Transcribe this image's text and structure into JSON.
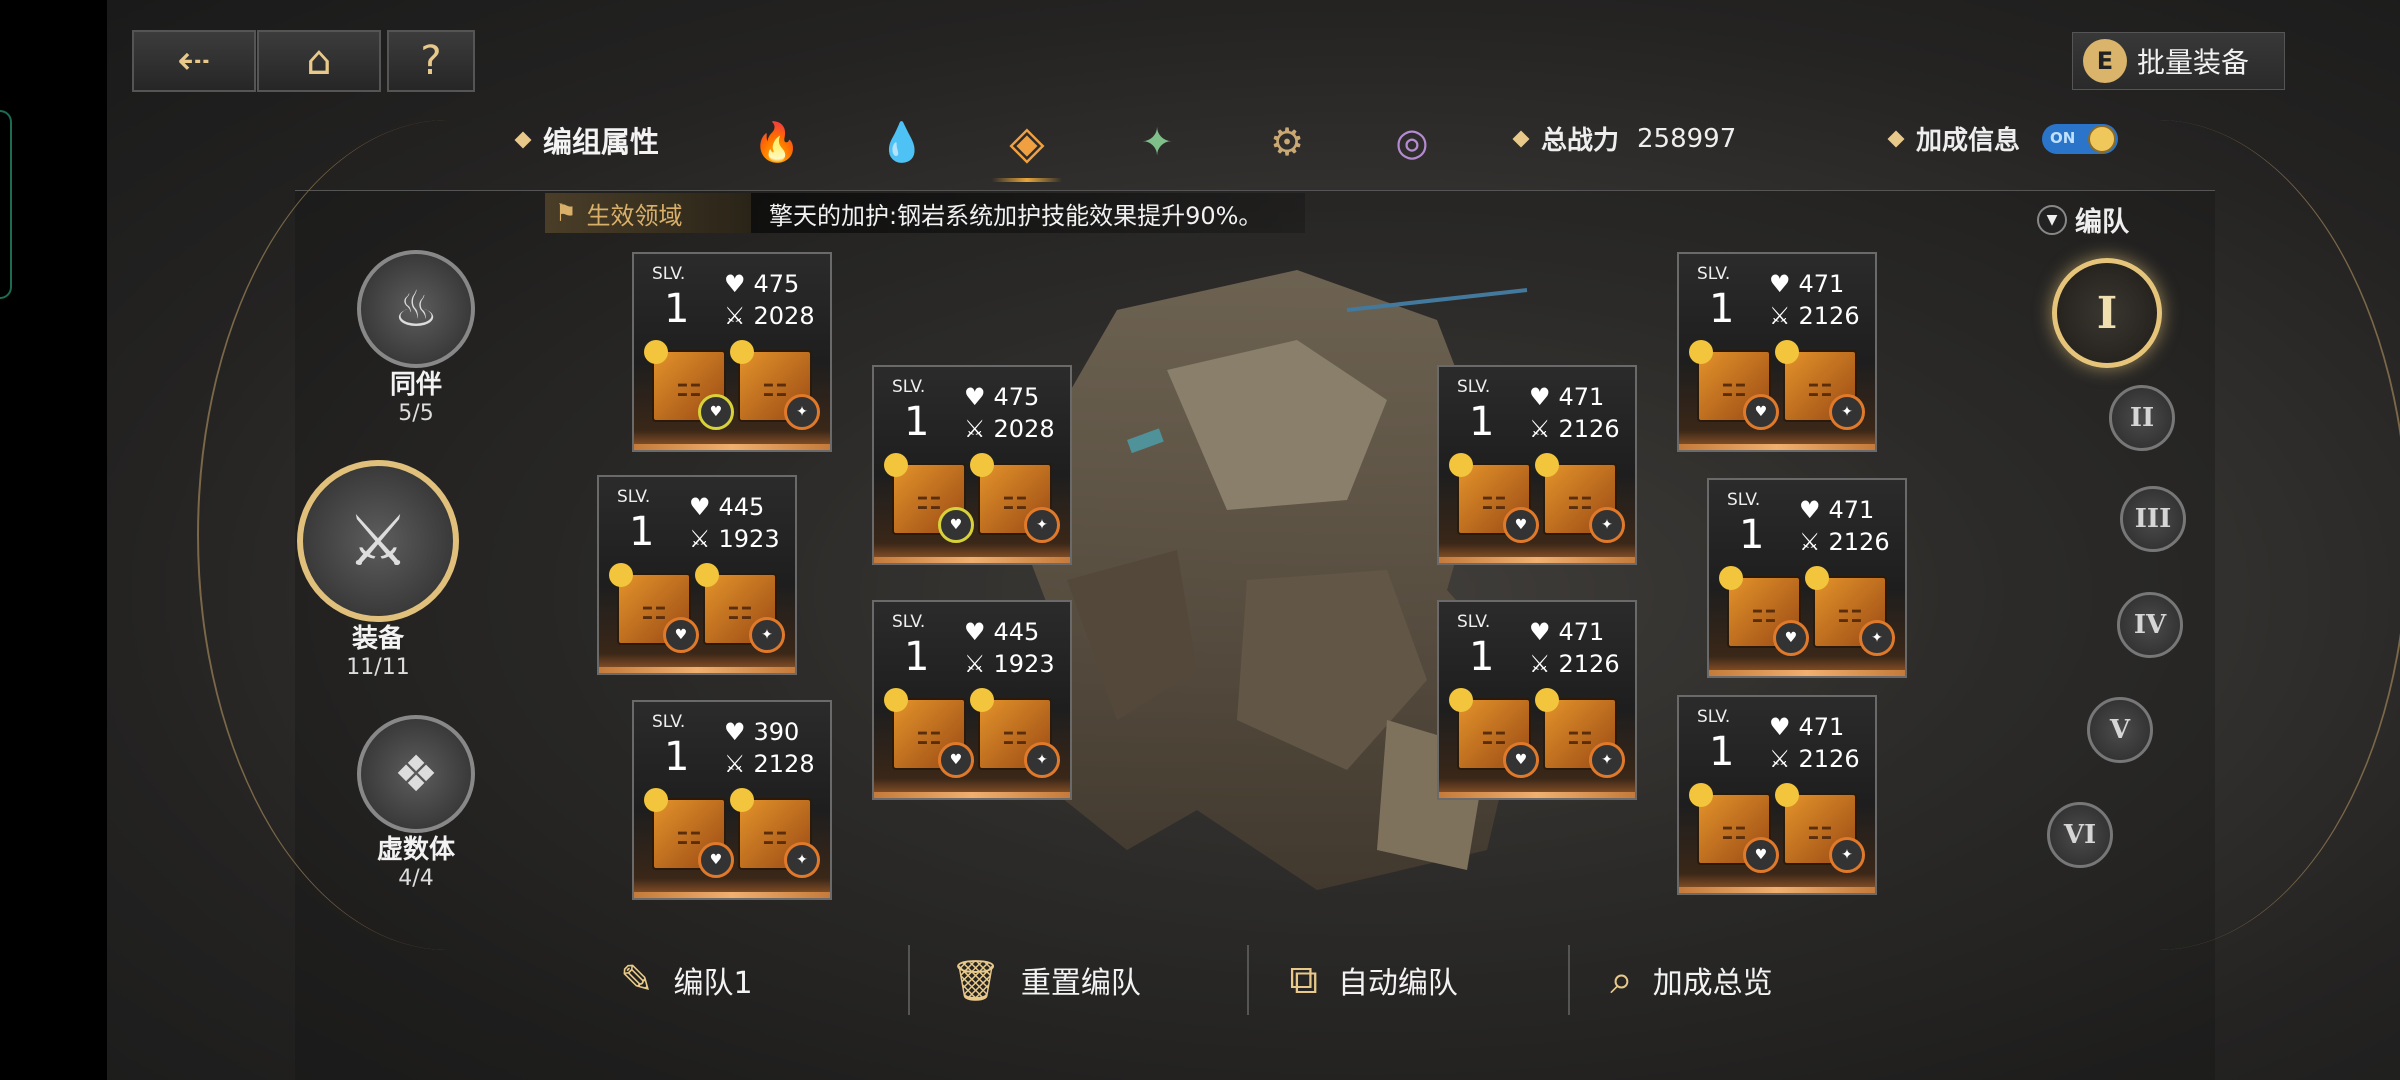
{
  "nav": {
    "back_icon": "back-arrow-icon",
    "home_icon": "home-icon",
    "help_label": "?"
  },
  "batch_equip": {
    "key": "E",
    "label": "批量装备"
  },
  "attributes": {
    "label": "编组属性",
    "elements": [
      {
        "name": "fire-element-icon",
        "glyph": "🔥",
        "color": "#c8746a"
      },
      {
        "name": "water-element-icon",
        "glyph": "💧",
        "color": "#6fa6d8"
      },
      {
        "name": "steel-element-icon",
        "glyph": "◈",
        "color": "#f0a040"
      },
      {
        "name": "wind-element-icon",
        "glyph": "✦",
        "color": "#7fbf8a"
      },
      {
        "name": "gear-element-icon",
        "glyph": "⚙",
        "color": "#c9a874"
      },
      {
        "name": "void-element-icon",
        "glyph": "◎",
        "color": "#b58ad2"
      }
    ]
  },
  "power": {
    "label": "总战力",
    "value": "258997"
  },
  "bonus": {
    "label": "加成信息",
    "toggle": "ON"
  },
  "effect": {
    "tag": "生效领域",
    "text": "擎天的加护:钢岩系统加护技能效果提升90%。"
  },
  "team_dropdown": "编队",
  "left_menu": [
    {
      "title": "同伴",
      "count": "5/5"
    },
    {
      "title": "装备",
      "count": "11/11"
    },
    {
      "title": "虚数体",
      "count": "4/4"
    }
  ],
  "teams": [
    "I",
    "II",
    "III",
    "IV",
    "V",
    "VI"
  ],
  "cards": [
    {
      "slv": "SLV.",
      "lvl": "1",
      "hp": "475",
      "atk": "2028"
    },
    {
      "slv": "SLV.",
      "lvl": "1",
      "hp": "475",
      "atk": "2028"
    },
    {
      "slv": "SLV.",
      "lvl": "1",
      "hp": "445",
      "atk": "1923"
    },
    {
      "slv": "SLV.",
      "lvl": "1",
      "hp": "445",
      "atk": "1923"
    },
    {
      "slv": "SLV.",
      "lvl": "1",
      "hp": "390",
      "atk": "2128"
    },
    {
      "slv": "SLV.",
      "lvl": "1",
      "hp": "471",
      "atk": "2126"
    },
    {
      "slv": "SLV.",
      "lvl": "1",
      "hp": "471",
      "atk": "2126"
    },
    {
      "slv": "SLV.",
      "lvl": "1",
      "hp": "471",
      "atk": "2126"
    },
    {
      "slv": "SLV.",
      "lvl": "1",
      "hp": "471",
      "atk": "2126"
    },
    {
      "slv": "SLV.",
      "lvl": "1",
      "hp": "471",
      "atk": "2126"
    }
  ],
  "bottom": [
    {
      "label": "编队1",
      "icon": "feather-pen-icon"
    },
    {
      "label": "重置编队",
      "icon": "trash-icon"
    },
    {
      "label": "自动编队",
      "icon": "auto-team-icon"
    },
    {
      "label": "加成总览",
      "icon": "magnifier-icon"
    }
  ]
}
